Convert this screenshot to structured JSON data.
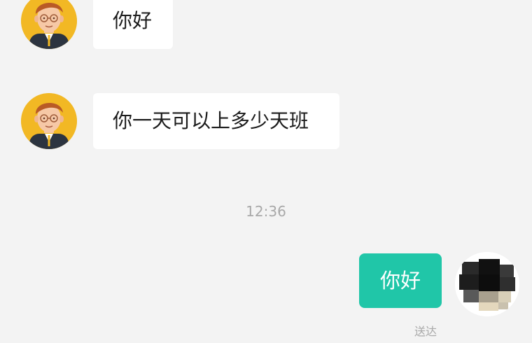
{
  "messages": [
    {
      "direction": "received",
      "text": "你好",
      "avatar": "cartoon-man-avatar"
    },
    {
      "direction": "received",
      "text": "你一天可以上多少天班",
      "avatar": "cartoon-man-avatar"
    },
    {
      "direction": "sent",
      "text": "你好",
      "status": "送达",
      "avatar": "pixelated-self-avatar"
    }
  ],
  "timestamp": "12:36",
  "colors": {
    "background": "#f3f3f3",
    "received_bubble": "#ffffff",
    "sent_bubble": "#20c6a8",
    "avatar_bg": "#f2b824"
  }
}
